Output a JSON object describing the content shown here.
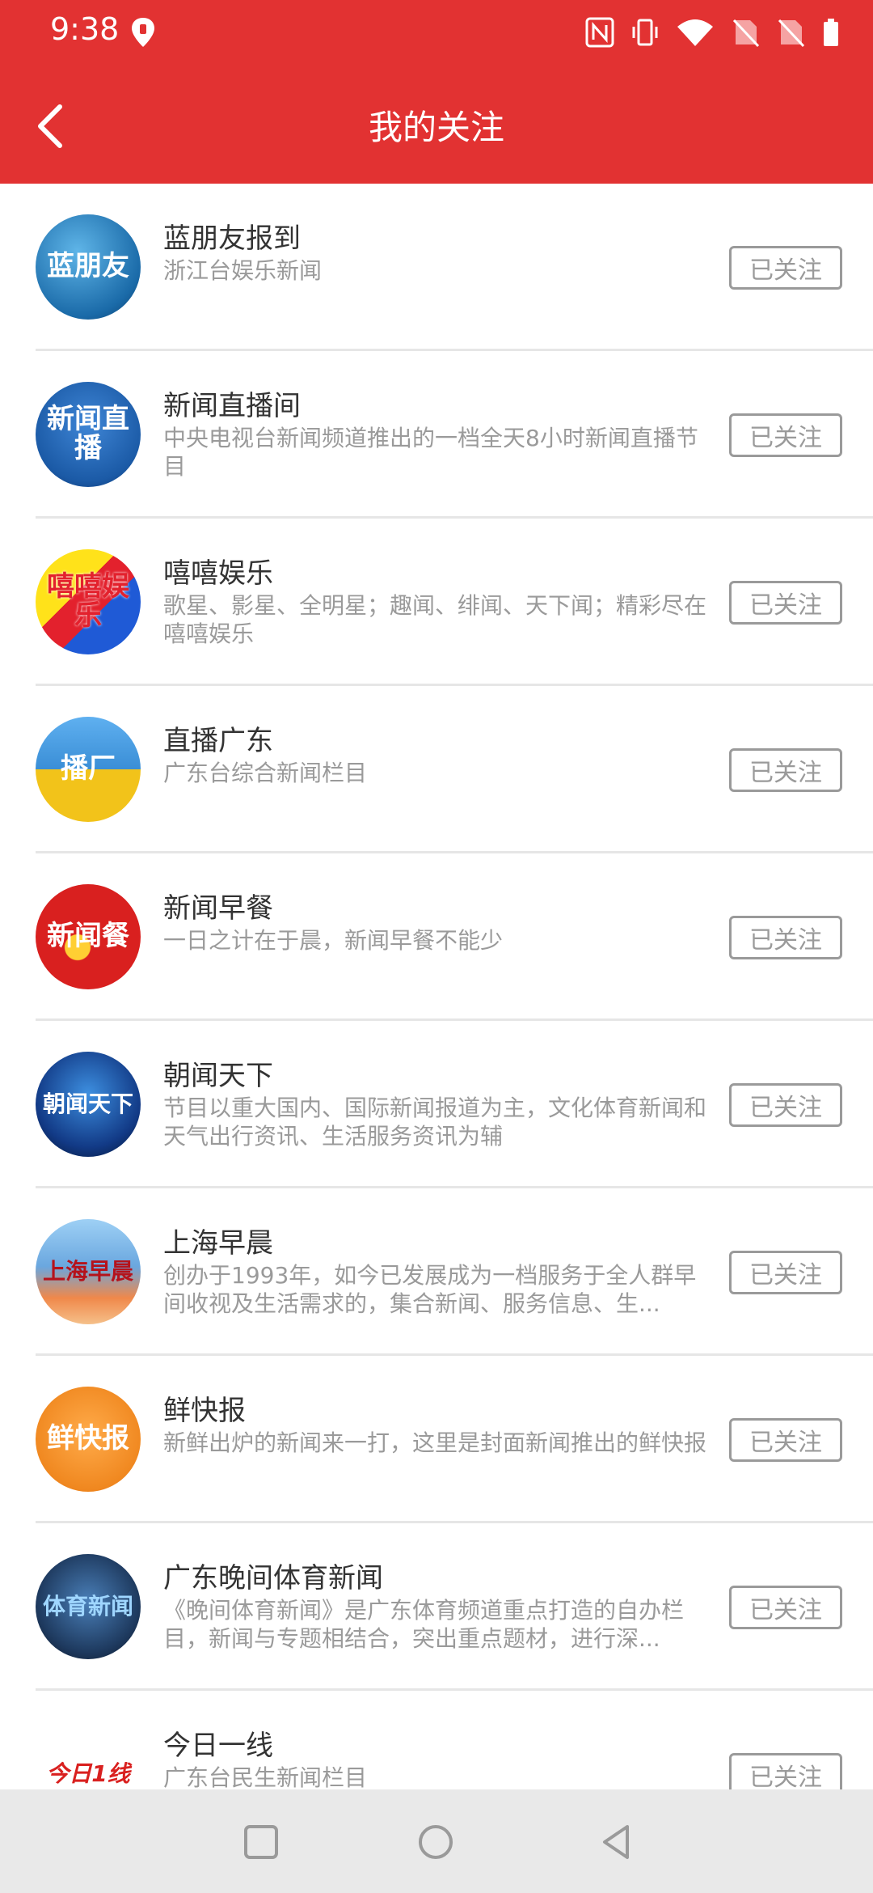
{
  "status_bar": {
    "time": "9:38",
    "icons": [
      "location-icon",
      "nfc-icon",
      "vibrate-icon",
      "wifi-icon",
      "sim1-icon",
      "sim2-icon",
      "battery-icon"
    ]
  },
  "header": {
    "title": "我的关注",
    "back_icon": "back-arrow-icon",
    "background_color": "#e23232"
  },
  "items": [
    {
      "name": "蓝朋友报到",
      "desc": "浙江台娱乐新闻",
      "button": "已关注",
      "avatar_text": "蓝朋友",
      "avatar_color": "#1a6aa8"
    },
    {
      "name": "新闻直播间",
      "desc": "中央电视台新闻频道推出的一档全天8小时新闻直播节目",
      "button": "已关注",
      "avatar_text": "新闻直播",
      "avatar_color": "#1b5aa6"
    },
    {
      "name": "嘻嘻娱乐",
      "desc": "歌星、影星、全明星；趣闻、绯闻、天下闻；精彩尽在嘻嘻娱乐",
      "button": "已关注",
      "avatar_text": "嘻嘻娱乐",
      "avatar_color": "#e3212d"
    },
    {
      "name": "直播广东",
      "desc": "广东台综合新闻栏目",
      "button": "已关注",
      "avatar_text": "播厂",
      "avatar_color": "#3a8ed6"
    },
    {
      "name": "新闻早餐",
      "desc": "一日之计在于晨，新闻早餐不能少",
      "button": "已关注",
      "avatar_text": "新闻餐",
      "avatar_color": "#d9201f"
    },
    {
      "name": "朝闻天下",
      "desc": "节目以重大国内、国际新闻报道为主，文化体育新闻和天气出行资讯、生活服务资讯为辅",
      "button": "已关注",
      "avatar_text": "朝闻天下",
      "avatar_color": "#123a86"
    },
    {
      "name": "上海早晨",
      "desc": "创办于1993年，如今已发展成为一档服务于全人群早间收视及生活需求的，集合新闻、服务信息、生...",
      "button": "已关注",
      "avatar_text": "上海早晨",
      "avatar_color": "#6aa7df"
    },
    {
      "name": "鲜快报",
      "desc": "新鲜出炉的新闻来一打，这里是封面新闻推出的鲜快报",
      "button": "已关注",
      "avatar_text": "鲜快报",
      "avatar_color": "#f08820"
    },
    {
      "name": "广东晚间体育新闻",
      "desc": "《晚间体育新闻》是广东体育频道重点打造的自办栏目，新闻与专题相结合，突出重点题材，进行深...",
      "button": "已关注",
      "avatar_text": "体育新闻",
      "avatar_color": "#1e3a5f"
    },
    {
      "name": "今日一线",
      "desc": "广东台民生新闻栏目",
      "button": "已关注",
      "avatar_text": "今日1线",
      "avatar_color": "#ffffff"
    }
  ],
  "nav_bar": {
    "buttons": [
      "recents-square-icon",
      "home-circle-icon",
      "back-triangle-icon"
    ]
  }
}
